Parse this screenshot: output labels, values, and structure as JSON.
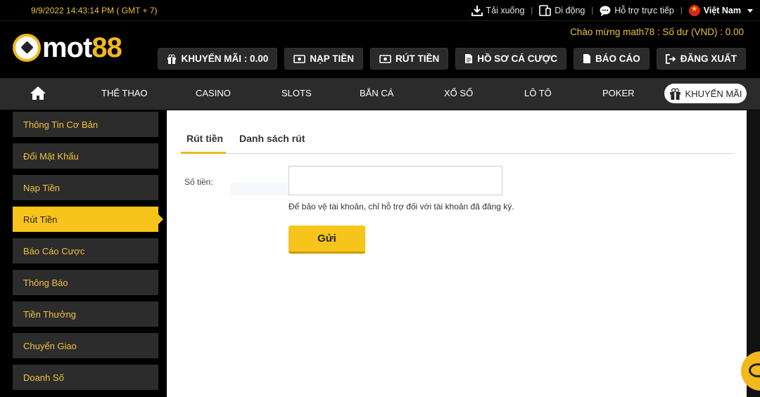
{
  "topbar": {
    "datetime": "9/9/2022 14:43:14 PM ( GMT + 7)",
    "download": "Tải xuống",
    "mobile": "Di động",
    "support": "Hỗ trợ trực tiếp",
    "language": "Việt Nam",
    "separator": "|"
  },
  "header": {
    "logo_white": "mot",
    "logo_yellow": "88",
    "welcome": "Chào mừng math78  :  Số dư (VND) : 0.00",
    "buttons": {
      "promo": "KHUYẾN MÃI : 0.00",
      "deposit": "NẠP TIỀN",
      "withdraw": "RÚT TIỀN",
      "bet_history": "HỒ SƠ CÁ CƯỢC",
      "report": "BÁO CÁO",
      "logout": "ĐĂNG XUẤT"
    }
  },
  "nav": {
    "items": [
      "THỂ THAO",
      "CASINO",
      "SLOTS",
      "BẮN CÁ",
      "XỔ SỐ",
      "LÔ TÔ",
      "POKER"
    ],
    "promo": "KHUYẾN MÃI"
  },
  "sidebar": {
    "items": [
      {
        "label": "Thông Tin Cơ Bản"
      },
      {
        "label": "Đổi Mật Khẩu"
      },
      {
        "label": "Nạp Tiền"
      },
      {
        "label": "Rút Tiền"
      },
      {
        "label": "Báo Cáo Cược"
      },
      {
        "label": "Thông Báo"
      },
      {
        "label": "Tiền Thưởng"
      },
      {
        "label": "Chuyển Giao"
      },
      {
        "label": "Doanh Số"
      }
    ],
    "active_index": 3
  },
  "main": {
    "tabs": [
      {
        "label": "Rút tiền"
      },
      {
        "label": "Danh sách rút"
      }
    ],
    "form": {
      "amount_label": "Số tiền:",
      "amount_value": "",
      "hint": "Để bảo vệ tài khoản, chỉ hỗ trợ đối với tài khoản đã đăng ký.",
      "submit": "Gửi"
    }
  },
  "colors": {
    "accent": "#f6c41a",
    "sidebar_text": "#f0c23c",
    "nav_bg": "#2b2b2b"
  }
}
